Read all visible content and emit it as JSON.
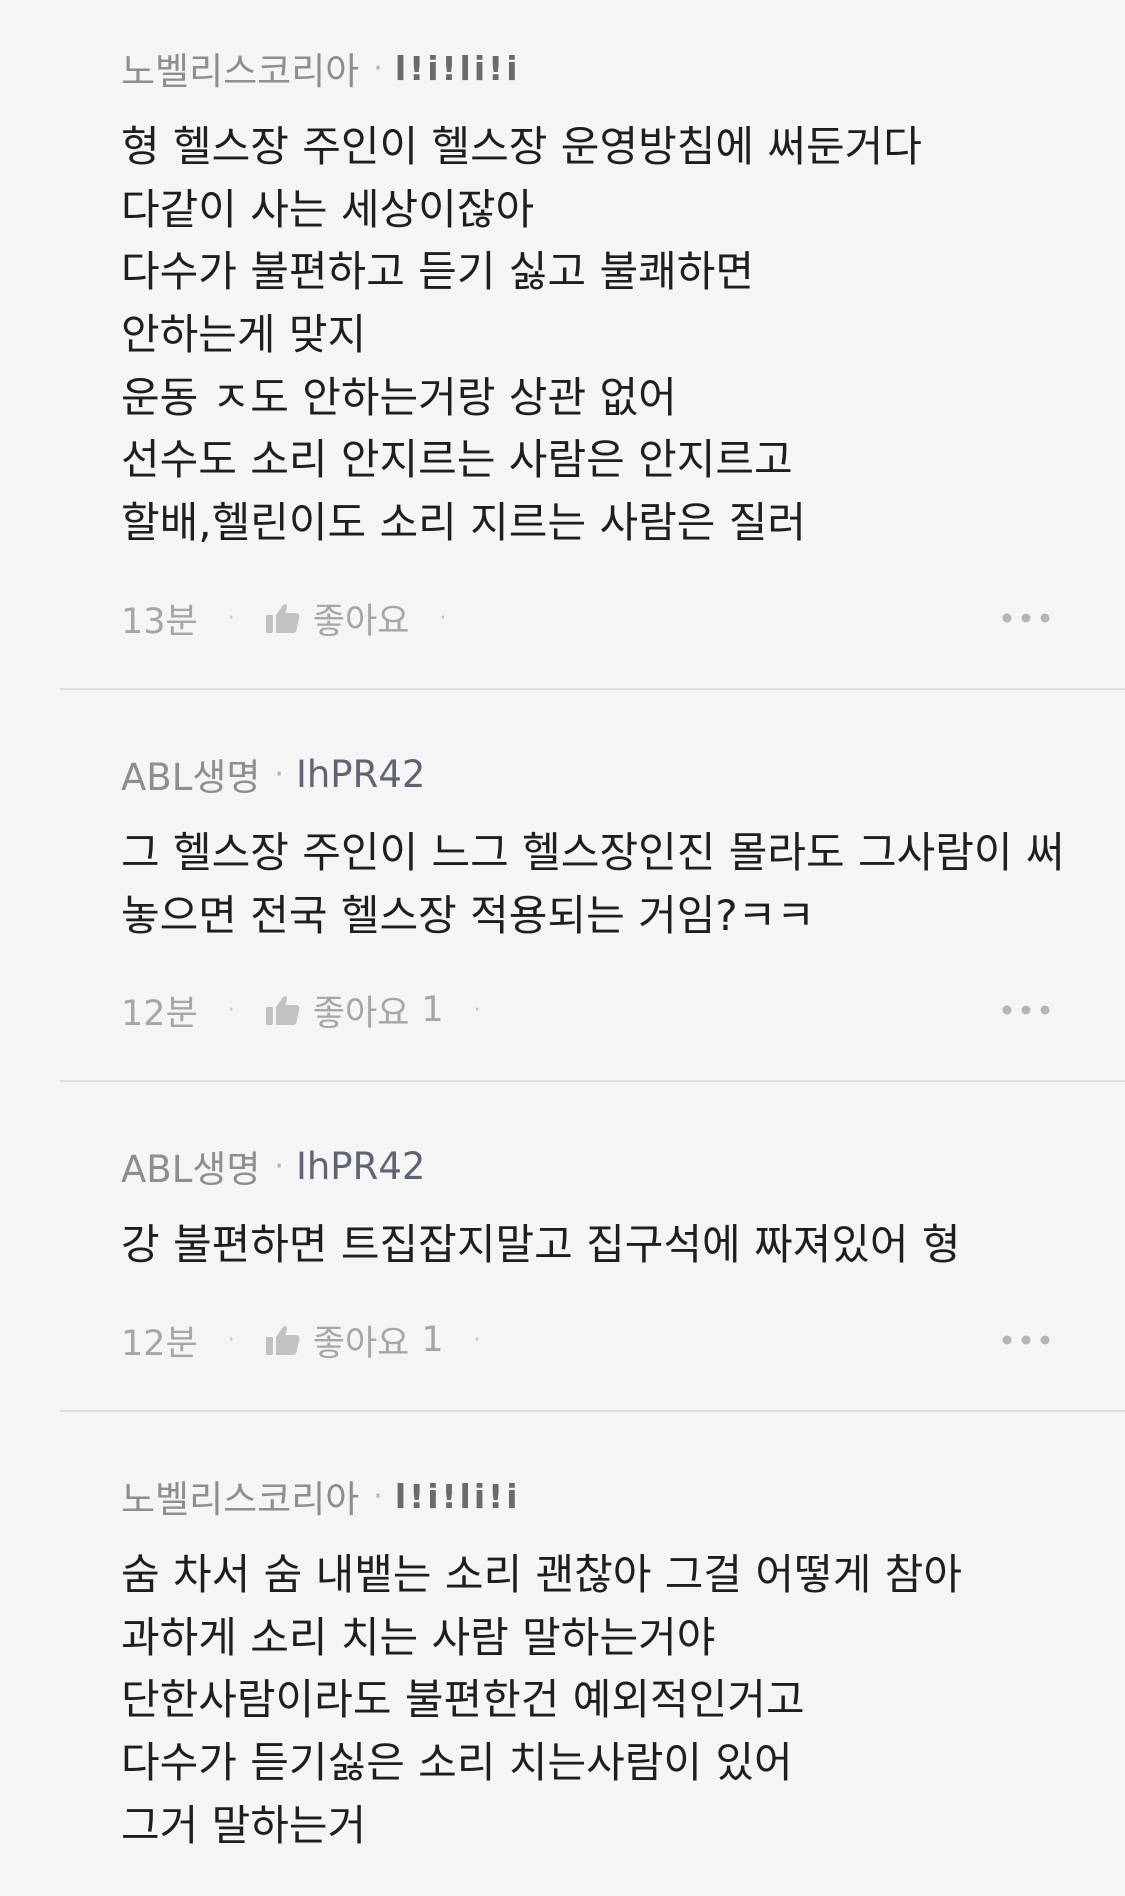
{
  "separator": "·",
  "comments": [
    {
      "author": "노벨리스코리아",
      "user_id": "l!i!li!i",
      "lines": [
        "형 헬스장 주인이 헬스장 운영방침에 써둔거다",
        "다같이 사는 세상이잖아",
        "다수가 불편하고 듣기 싫고 불쾌하면",
        "안하는게 맞지",
        "운동 ㅈ도 안하는거랑 상관 없어",
        "선수도 소리 안지르는 사람은 안지르고",
        "할배,헬린이도 소리 지르는 사람은 질러"
      ],
      "time": "13분",
      "like_label": "좋아요",
      "like_count": ""
    },
    {
      "author": "ABL생명",
      "user_id": "IhPR42",
      "lines": [
        "그 헬스장 주인이 느그 헬스장인진 몰라도 그사람이 써",
        "놓으면 전국 헬스장 적용되는 거임?ㅋㅋ"
      ],
      "time": "12분",
      "like_label": "좋아요",
      "like_count": "1"
    },
    {
      "author": "ABL생명",
      "user_id": "IhPR42",
      "lines": [
        "강 불편하면 트집잡지말고 집구석에 짜져있어 형"
      ],
      "time": "12분",
      "like_label": "좋아요",
      "like_count": "1"
    },
    {
      "author": "노벨리스코리아",
      "user_id": "l!i!li!i",
      "lines": [
        "숨 차서 숨 내뱉는 소리 괜찮아 그걸 어떻게 참아",
        "과하게 소리 치는 사람 말하는거야",
        "단한사람이라도 불편한건 예외적인거고",
        "다수가 듣기싫은 소리 치는사람이 있어",
        "그거 말하는거"
      ]
    }
  ],
  "icons": {
    "like": "thumbs-up-icon",
    "more": "more-dots-icon"
  },
  "colors": {
    "background": "#f5f5f5",
    "meta_text": "#8e8e8e",
    "user_id": "#5e6472",
    "body_text": "#1e1e1e",
    "action_text": "#a6a6a6",
    "divider": "#dedede"
  }
}
